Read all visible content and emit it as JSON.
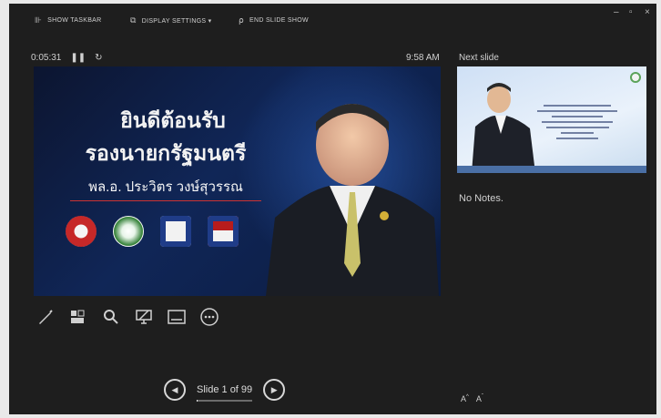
{
  "toolbar": {
    "show_taskbar": "SHOW TASKBAR",
    "display_settings": "DISPLAY SETTINGS ▾",
    "end_slide_show": "END SLIDE SHOW"
  },
  "window_controls": {
    "minimize": "–",
    "restore": "▫",
    "close": "×"
  },
  "presenter": {
    "elapsed_time": "0:05:31",
    "clock": "9:58 AM",
    "next_slide_label": "Next slide",
    "notes": "No Notes.",
    "slide_counter": "Slide 1 of 99",
    "slide_progress": 0.0101
  },
  "current_slide": {
    "title_line1": "ยินดีต้อนรับ",
    "title_line2": "รองนายกรัฐมนตรี",
    "name": "พล.อ. ประวิตร วงษ์สุวรรณ"
  },
  "tools": [
    "pen-icon",
    "zoom-slides-icon",
    "magnifier-icon",
    "black-screen-icon",
    "subtitles-icon",
    "more-options-icon"
  ],
  "colors": {
    "background": "#1e1e1e",
    "slide_bg": "#102657",
    "accent_red": "#cc3333"
  }
}
